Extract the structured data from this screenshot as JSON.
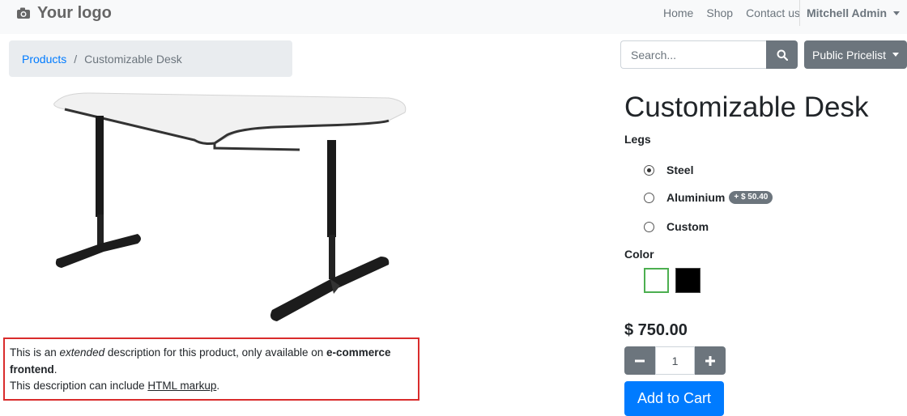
{
  "header": {
    "logo_text": "Your logo",
    "nav": [
      "Home",
      "Shop",
      "Contact us"
    ],
    "user_name": "Mitchell Admin"
  },
  "breadcrumb": {
    "parent": "Products",
    "separator": "/",
    "current": "Customizable Desk"
  },
  "search": {
    "placeholder": "Search..."
  },
  "pricelist": {
    "label": "Public Pricelist"
  },
  "product": {
    "title": "Customizable Desk",
    "legs_label": "Legs",
    "legs_options": [
      {
        "label": "Steel",
        "selected": true
      },
      {
        "label": "Aluminium",
        "extra": "+ $ 50.40",
        "selected": false
      },
      {
        "label": "Custom",
        "selected": false
      }
    ],
    "color_label": "Color",
    "colors": [
      {
        "name": "White",
        "hex": "#ffffff",
        "selected": true
      },
      {
        "name": "Black",
        "hex": "#000000",
        "selected": false
      }
    ],
    "price": "$ 750.00",
    "quantity": "1",
    "add_to_cart": "Add to Cart"
  },
  "description": {
    "p1_prefix": "This is an ",
    "p1_em": "extended",
    "p1_mid": " description for this product, only available on ",
    "p1_strong": "e-commerce frontend",
    "p1_end": ".",
    "p2_prefix": "This description can include ",
    "p2_link": "HTML markup",
    "p2_end": "."
  },
  "colors": {
    "primary": "#007bff",
    "secondary": "#6c757d",
    "highlight_border": "#d92c2c",
    "selected_swatch": "#4caf50"
  }
}
